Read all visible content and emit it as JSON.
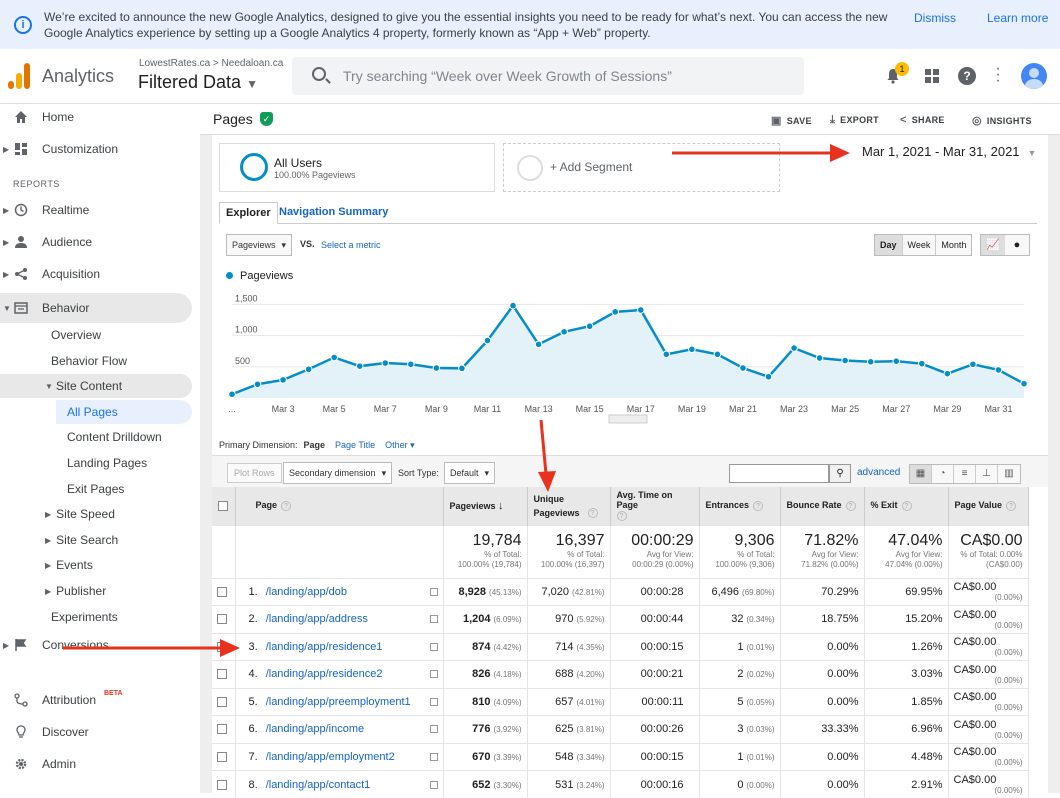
{
  "banner": {
    "text": "We’re excited to announce the new Google Analytics, designed to give you the essential insights you need to be ready for what’s next. You can access the new Google Analytics experience by setting up a Google Analytics 4 property, formerly known as “App + Web” property.",
    "dismiss": "Dismiss",
    "learn_more": "Learn more"
  },
  "header": {
    "app_name": "Analytics",
    "account_path": "LowestRates.ca > Needaloan.ca",
    "view_name": "Filtered Data",
    "search_placeholder": "Try searching “Week over Week Growth of Sessions”",
    "notification_count": "1"
  },
  "sidebar": {
    "home": "Home",
    "customization": "Customization",
    "reports_label": "REPORTS",
    "realtime": "Realtime",
    "audience": "Audience",
    "acquisition": "Acquisition",
    "behavior": "Behavior",
    "overview": "Overview",
    "behavior_flow": "Behavior Flow",
    "site_content": "Site Content",
    "all_pages": "All Pages",
    "content_drilldown": "Content Drilldown",
    "landing_pages": "Landing Pages",
    "exit_pages": "Exit Pages",
    "site_speed": "Site Speed",
    "site_search": "Site Search",
    "events": "Events",
    "publisher": "Publisher",
    "experiments": "Experiments",
    "conversions": "Conversions",
    "attribution": "Attribution",
    "attribution_badge": "BETA",
    "discover": "Discover",
    "admin": "Admin"
  },
  "report": {
    "title": "Pages",
    "save": "SAVE",
    "export": "EXPORT",
    "share": "SHARE",
    "insights": "INSIGHTS",
    "segment_name": "All Users",
    "segment_sub": "100.00% Pageviews",
    "add_segment": "+ Add Segment",
    "date_range": "Mar 1, 2021 - Mar 31, 2021",
    "tab_explorer": "Explorer",
    "tab_nav_summary": "Navigation Summary",
    "metric_select": "Pageviews",
    "vs": "VS.",
    "select_metric": "Select a metric",
    "period_day": "Day",
    "period_week": "Week",
    "period_month": "Month",
    "primary_dimension_label": "Primary Dimension:",
    "dim_page": "Page",
    "dim_page_title": "Page Title",
    "dim_other": "Other",
    "plot_rows": "Plot Rows",
    "secondary_dimension": "Secondary dimension",
    "sort_type_label": "Sort Type:",
    "sort_type": "Default",
    "advanced": "advanced"
  },
  "chart_data": {
    "type": "area",
    "series": [
      {
        "name": "Pageviews",
        "values": [
          60,
          220,
          290,
          460,
          650,
          510,
          560,
          540,
          480,
          475,
          920,
          1480,
          860,
          1060,
          1150,
          1380,
          1410,
          700,
          780,
          700,
          480,
          340,
          800,
          640,
          600,
          580,
          590,
          550,
          390,
          540,
          450,
          230
        ]
      }
    ],
    "x": [
      "Mar 1",
      "Mar 2",
      "Mar 3",
      "Mar 4",
      "Mar 5",
      "Mar 6",
      "Mar 7",
      "Mar 8",
      "Mar 9",
      "Mar 10",
      "Mar 11",
      "Mar 12",
      "Mar 13",
      "Mar 14",
      "Mar 15",
      "Mar 16",
      "Mar 17",
      "Mar 18",
      "Mar 19",
      "Mar 20",
      "Mar 21",
      "Mar 22",
      "Mar 23",
      "Mar 24",
      "Mar 25",
      "Mar 26",
      "Mar 27",
      "Mar 28",
      "Mar 29",
      "Mar 30",
      "Mar 31"
    ],
    "x_tick_labels": [
      "...",
      "Mar 3",
      "Mar 5",
      "Mar 7",
      "Mar 9",
      "Mar 11",
      "Mar 13",
      "Mar 15",
      "Mar 17",
      "Mar 19",
      "Mar 21",
      "Mar 23",
      "Mar 25",
      "Mar 27",
      "Mar 29",
      "Mar 31"
    ],
    "y_tick_labels": [
      "1,500",
      "1,000",
      "500"
    ],
    "ylim": [
      0,
      1650
    ],
    "color": "#058dc7",
    "fill": "#e3f1f9"
  },
  "table": {
    "headers": [
      "Page",
      "Pageviews",
      "Unique Pageviews",
      "Avg. Time on Page",
      "Entrances",
      "Bounce Rate",
      "% Exit",
      "Page Value"
    ],
    "totals": [
      {
        "value": "19,784",
        "l1": "% of Total:",
        "l2": "100.00% (19,784)"
      },
      {
        "value": "16,397",
        "l1": "% of Total:",
        "l2": "100.00% (16,397)"
      },
      {
        "value": "00:00:29",
        "l1": "Avg for View:",
        "l2": "00:00:29 (0.00%)"
      },
      {
        "value": "9,306",
        "l1": "% of Total:",
        "l2": "100.00% (9,306)"
      },
      {
        "value": "71.82%",
        "l1": "Avg for View:",
        "l2": "71.82% (0.00%)"
      },
      {
        "value": "47.04%",
        "l1": "Avg for View:",
        "l2": "47.04% (0.00%)"
      },
      {
        "value": "CA$0.00",
        "l1": "% of Total: 0.00%",
        "l2": "(CA$0.00)"
      }
    ],
    "rows": [
      {
        "n": "1.",
        "page": "/landing/app/dob",
        "pv": "8,928",
        "pvp": "(45.13%)",
        "upv": "7,020",
        "upvp": "(42.81%)",
        "time": "00:00:28",
        "ent": "6,496",
        "entp": "(69.80%)",
        "br": "70.29%",
        "exit": "69.95%",
        "val": "CA$0.00",
        "valp": "(0.00%)"
      },
      {
        "n": "2.",
        "page": "/landing/app/address",
        "pv": "1,204",
        "pvp": "(6.09%)",
        "upv": "970",
        "upvp": "(5.92%)",
        "time": "00:00:44",
        "ent": "32",
        "entp": "(0.34%)",
        "br": "18.75%",
        "exit": "15.20%",
        "val": "CA$0.00",
        "valp": "(0.00%)"
      },
      {
        "n": "3.",
        "page": "/landing/app/residence1",
        "pv": "874",
        "pvp": "(4.42%)",
        "upv": "714",
        "upvp": "(4.35%)",
        "time": "00:00:15",
        "ent": "1",
        "entp": "(0.01%)",
        "br": "0.00%",
        "exit": "1.26%",
        "val": "CA$0.00",
        "valp": "(0.00%)"
      },
      {
        "n": "4.",
        "page": "/landing/app/residence2",
        "pv": "826",
        "pvp": "(4.18%)",
        "upv": "688",
        "upvp": "(4.20%)",
        "time": "00:00:21",
        "ent": "2",
        "entp": "(0.02%)",
        "br": "0.00%",
        "exit": "3.03%",
        "val": "CA$0.00",
        "valp": "(0.00%)"
      },
      {
        "n": "5.",
        "page": "/landing/app/preemployment1",
        "pv": "810",
        "pvp": "(4.09%)",
        "upv": "657",
        "upvp": "(4.01%)",
        "time": "00:00:11",
        "ent": "5",
        "entp": "(0.05%)",
        "br": "0.00%",
        "exit": "1.85%",
        "val": "CA$0.00",
        "valp": "(0.00%)"
      },
      {
        "n": "6.",
        "page": "/landing/app/income",
        "pv": "776",
        "pvp": "(3.92%)",
        "upv": "625",
        "upvp": "(3.81%)",
        "time": "00:00:26",
        "ent": "3",
        "entp": "(0.03%)",
        "br": "33.33%",
        "exit": "6.96%",
        "val": "CA$0.00",
        "valp": "(0.00%)"
      },
      {
        "n": "7.",
        "page": "/landing/app/employment2",
        "pv": "670",
        "pvp": "(3.39%)",
        "upv": "548",
        "upvp": "(3.34%)",
        "time": "00:00:15",
        "ent": "1",
        "entp": "(0.01%)",
        "br": "0.00%",
        "exit": "4.48%",
        "val": "CA$0.00",
        "valp": "(0.00%)"
      },
      {
        "n": "8.",
        "page": "/landing/app/contact1",
        "pv": "652",
        "pvp": "(3.30%)",
        "upv": "531",
        "upvp": "(3.24%)",
        "time": "00:00:16",
        "ent": "0",
        "entp": "(0.00%)",
        "br": "0.00%",
        "exit": "2.91%",
        "val": "CA$0.00",
        "valp": "(0.00%)"
      }
    ]
  },
  "annotation_color": "#e8321e"
}
